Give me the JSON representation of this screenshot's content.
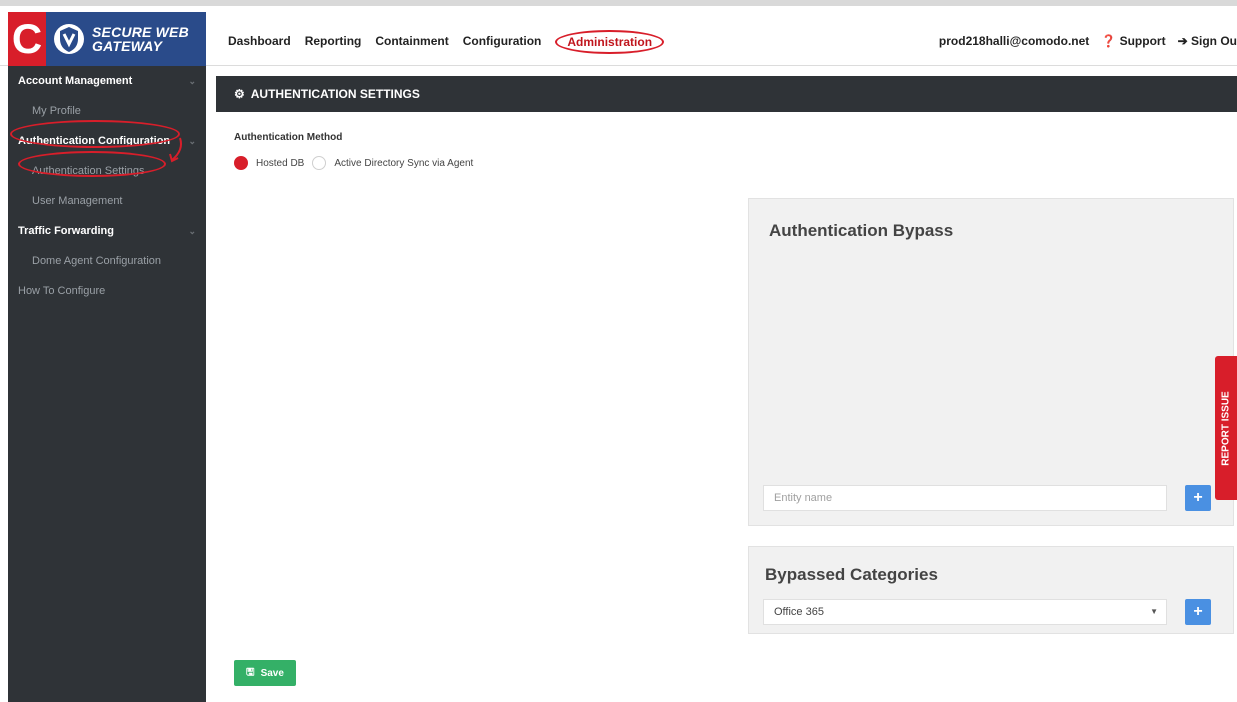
{
  "brand": {
    "logo_letter": "C",
    "line1": "SECURE WEB",
    "line2": "GATEWAY"
  },
  "nav": {
    "items": [
      "Dashboard",
      "Reporting",
      "Containment",
      "Configuration",
      "Administration"
    ]
  },
  "user": {
    "email": "prod218halli@comodo.net",
    "support": "Support",
    "signout": "Sign Ou"
  },
  "sidebar": {
    "sections": [
      {
        "label": "Account Management",
        "items": [
          "My Profile"
        ]
      },
      {
        "label": "Authentication Configuration",
        "items": [
          "Authentication Settings",
          "User Management"
        ]
      },
      {
        "label": "Traffic Forwarding",
        "items": [
          "Dome Agent Configuration"
        ]
      }
    ],
    "howto": "How To Configure"
  },
  "panel": {
    "title": "AUTHENTICATION SETTINGS"
  },
  "auth_method": {
    "label": "Authentication Method",
    "options": [
      "Hosted DB",
      "Active Directory Sync via Agent"
    ],
    "selected": "Hosted DB"
  },
  "bypass": {
    "title": "Authentication Bypass",
    "entity_placeholder": "Entity name",
    "add": "+"
  },
  "categories": {
    "title": "Bypassed Categories",
    "selected": "Office 365",
    "add": "+"
  },
  "save": {
    "label": "Save"
  },
  "report": {
    "label": "REPORT ISSUE"
  },
  "colors": {
    "accent": "#d81e2a",
    "sidebar": "#2f3337",
    "plus": "#4a90e2",
    "save": "#34b067"
  }
}
